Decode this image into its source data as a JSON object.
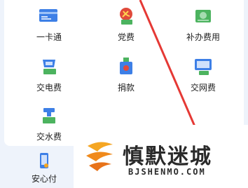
{
  "services": [
    {
      "label": "一卡通",
      "icon": "card-icon"
    },
    {
      "label": "党费",
      "icon": "party-emblem-icon"
    },
    {
      "label": "补办费用",
      "icon": "certificate-icon"
    },
    {
      "label": "交电费",
      "icon": "electric-meter-icon"
    },
    {
      "label": "捐款",
      "icon": "donation-box-icon"
    },
    {
      "label": "交网费",
      "icon": "monitor-icon"
    },
    {
      "label": "交水费",
      "icon": "water-faucet-icon"
    }
  ],
  "bottom_nav": {
    "label": "安心付",
    "icon": "phone-pay-icon"
  },
  "watermark": {
    "title": "慎默迷城",
    "subtitle": "BJSHENMO.COM"
  },
  "colors": {
    "blue": "#3d7fe6",
    "green": "#4cb35f",
    "red": "#e04a3b",
    "annotation": "#e53935"
  }
}
